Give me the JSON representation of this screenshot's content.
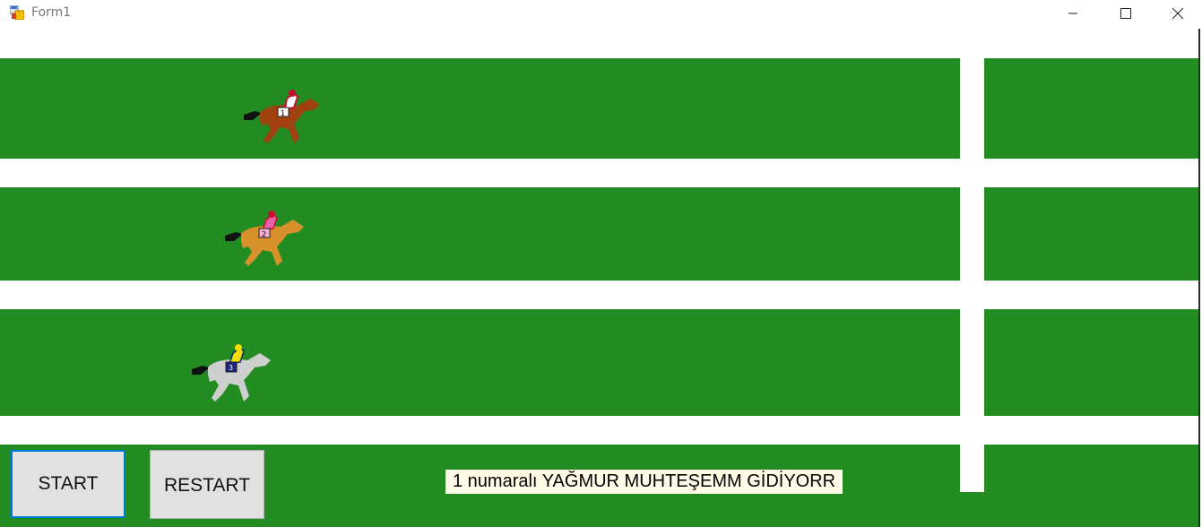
{
  "window": {
    "title": "Form1",
    "controls": [
      "minimize-icon",
      "maximize-icon",
      "close-icon"
    ]
  },
  "track": {
    "lane_color": "#228b22",
    "rail_color": "#ffffff"
  },
  "horses": [
    {
      "coat": "chestnut",
      "silks": "red-white",
      "color": "#a0420f",
      "saddle_number": "1"
    },
    {
      "coat": "golden",
      "silks": "pink",
      "color": "#d8912a",
      "saddle_number": "2"
    },
    {
      "coat": "grey",
      "silks": "yellow-navy",
      "color": "#cfcfcf",
      "saddle_number": "3"
    }
  ],
  "controls": {
    "start_label": "START",
    "restart_label": "RESTART"
  },
  "status": {
    "message": "1 numaralı YAĞMUR MUHTEŞEMM GİDİYORR"
  }
}
